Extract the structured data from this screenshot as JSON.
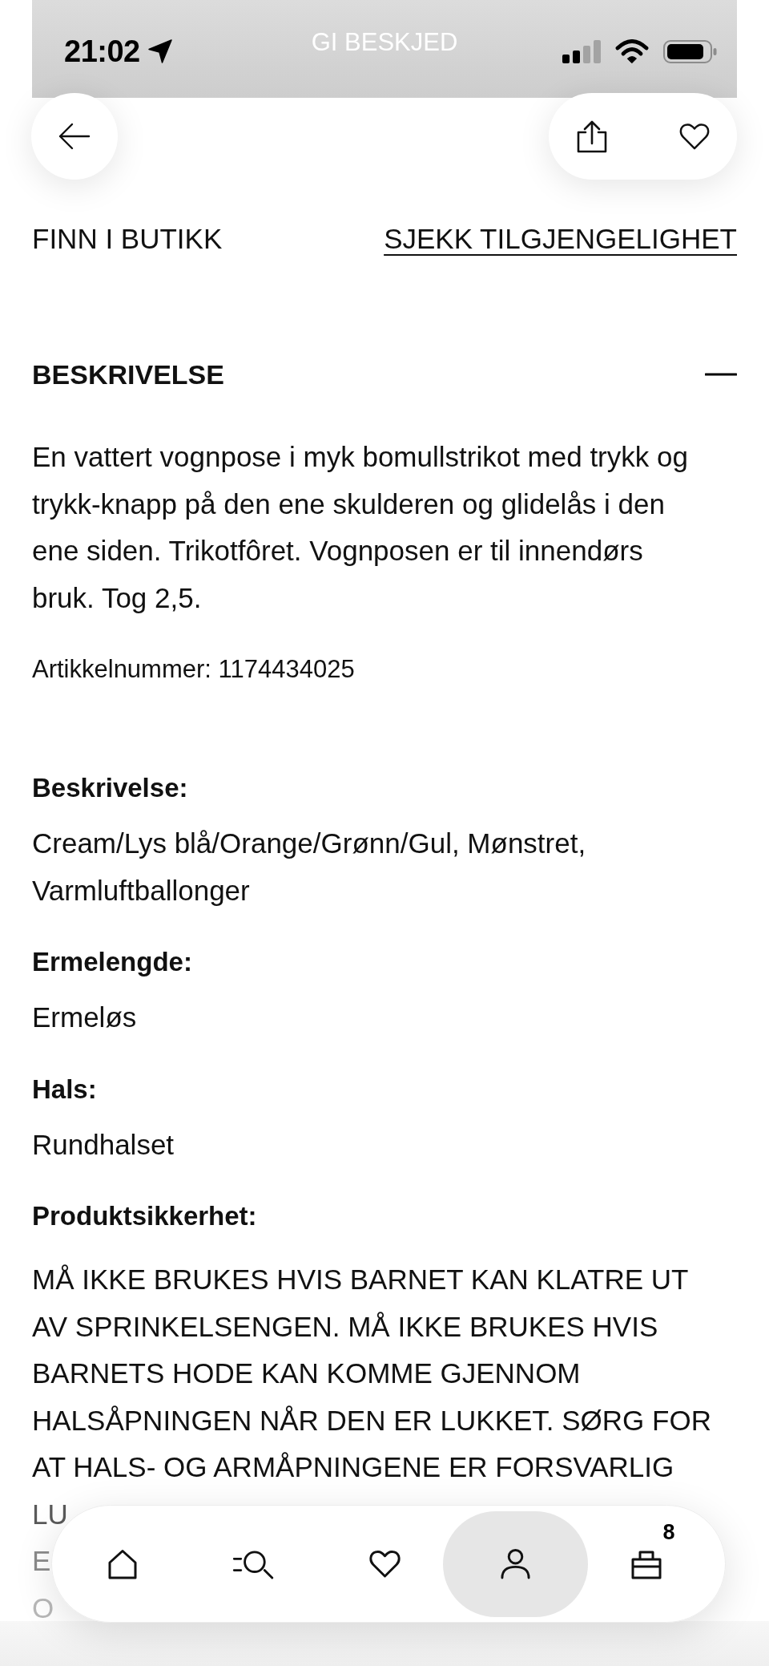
{
  "status_bar": {
    "time": "21:02",
    "banner_label": "GI BESKJED"
  },
  "store_links": {
    "find_in_store": "FINN I BUTIKK",
    "check_availability": "SJEKK TILGJENGELIGHET"
  },
  "description": {
    "title": "BESKRIVELSE",
    "expanded": true,
    "text": "En vattert vognpose i myk bomullstrikot med trykk og trykk-knapp på den ene skulderen og glidelås i den ene siden. Trikotfôret. Vognposen er til innendørs bruk. Tog 2,5.",
    "article_number": "Artikkelnummer: 1174434025"
  },
  "attributes": [
    {
      "kind": "text",
      "label": "Beskrivelse:",
      "value": "Cream/Lys blå/Orange/Grønn/Gul, Mønstret, Varmluftballonger"
    },
    {
      "kind": "text",
      "label": "Ermelengde:",
      "value": "Ermeløs"
    },
    {
      "kind": "text",
      "label": "Hals:",
      "value": "Rundhalset"
    },
    {
      "kind": "warning",
      "label": "Produktsikkerhet:",
      "value": "MÅ IKKE BRUKES HVIS BARNET KAN KLATRE UT AV SPRINKELSENGEN. MÅ IKKE BRUKES HVIS BARNETS HODE KAN KOMME GJENNOM HALSÅPNINGEN NÅR DEN ER LUKKET. SØRG FOR AT HALS- OG ARMÅPNINGENE ER FORSVARLIG",
      "covered_lines": [
        "LU",
        "E",
        "O"
      ]
    }
  ],
  "bottom_nav": {
    "items": [
      {
        "kind": "home",
        "selected": false
      },
      {
        "kind": "search",
        "selected": false
      },
      {
        "kind": "favorites",
        "selected": false
      },
      {
        "kind": "account",
        "selected": true
      },
      {
        "kind": "bag",
        "selected": false,
        "badge": "8"
      }
    ]
  }
}
